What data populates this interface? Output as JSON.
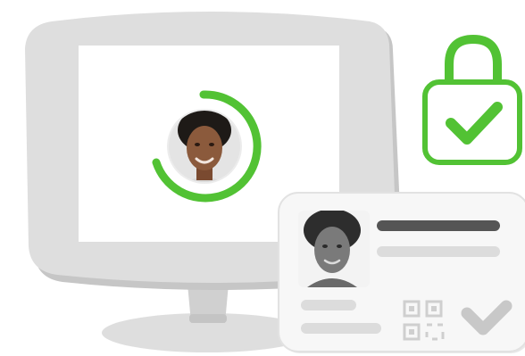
{
  "illustration": {
    "monitor": {
      "screen_color": "#ffffff",
      "frame_color": "#dedede",
      "shadow_color": "#bfbfbf"
    },
    "progress_ring": {
      "progress": 0.75,
      "color": "#52c234",
      "track_color": "#ffffff"
    },
    "lock": {
      "icon": "lock-icon",
      "color": "#52c234",
      "check_icon": "check-icon"
    },
    "id_card": {
      "background": "#f7f7f7",
      "placeholder_line_colors": [
        "#555555",
        "#dcdcdc"
      ],
      "qr_icon": "qr-code-icon",
      "verified_icon": "check-icon",
      "check_color": "#c8c8c8"
    },
    "colors": {
      "accent": "#52c234",
      "gray_light": "#e0e0e0",
      "gray_mid": "#c9c9c9",
      "skin": "#8b5a3c",
      "hair": "#1e1a17"
    }
  }
}
